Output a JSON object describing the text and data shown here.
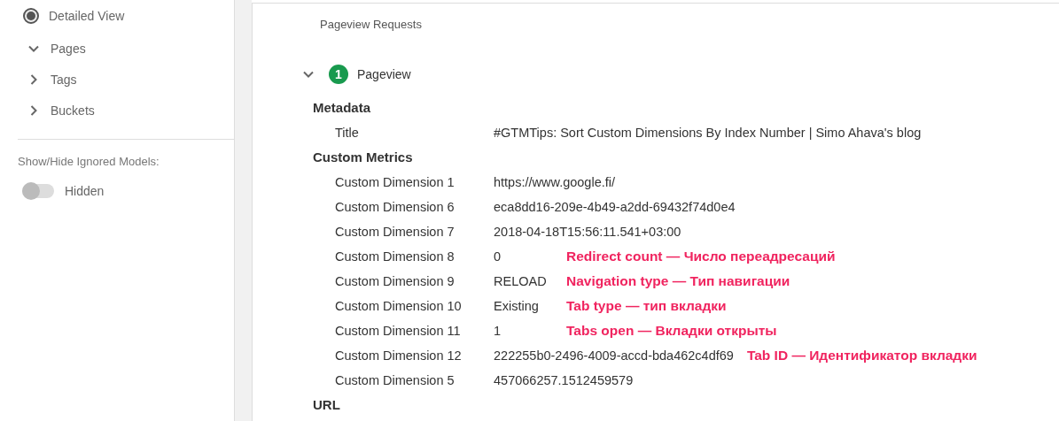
{
  "sidebar": {
    "view_option": {
      "label": "Detailed View",
      "selected": true
    },
    "tree": [
      {
        "label": "Pages",
        "expanded": true
      },
      {
        "label": "Tags",
        "expanded": false
      },
      {
        "label": "Buckets",
        "expanded": false
      }
    ],
    "ignored_models": {
      "label": "Show/Hide Ignored Models:",
      "on": false,
      "state_label": "Hidden"
    }
  },
  "main": {
    "section_title": "Pageview Requests",
    "requests": [
      {
        "number": "1",
        "label": "Pageview",
        "expanded": true,
        "groups": [
          {
            "heading": "Metadata",
            "rows": [
              {
                "name": "Title",
                "value": "#GTMTips: Sort Custom Dimensions By Index Number | Simo Ahava's blog"
              }
            ]
          },
          {
            "heading": "Custom Metrics",
            "rows": [
              {
                "name": "Custom Dimension 1",
                "value": "https://www.google.fi/"
              },
              {
                "name": "Custom Dimension 6",
                "value": "eca8dd16-209e-4b49-a2dd-69432f74d0e4"
              },
              {
                "name": "Custom Dimension 7",
                "value": "2018-04-18T15:56:11.541+03:00"
              },
              {
                "name": "Custom Dimension 8",
                "value": "0",
                "note": "Redirect count — Число переадресаций"
              },
              {
                "name": "Custom Dimension 9",
                "value": "RELOAD",
                "note": "Navigation type — Тип навигации"
              },
              {
                "name": "Custom Dimension 10",
                "value": "Existing",
                "note": "Tab type — тип вкладки"
              },
              {
                "name": "Custom Dimension 11",
                "value": "1",
                "note": "Tabs open — Вкладки открыты"
              },
              {
                "name": "Custom Dimension 12",
                "value": "222255b0-2496-4009-accd-bda462c4df69",
                "note": "Tab ID — Идентификатор вкладки"
              },
              {
                "name": "Custom Dimension 5",
                "value": "457066257.1512459579"
              }
            ]
          },
          {
            "heading": "URL"
          }
        ]
      }
    ]
  }
}
